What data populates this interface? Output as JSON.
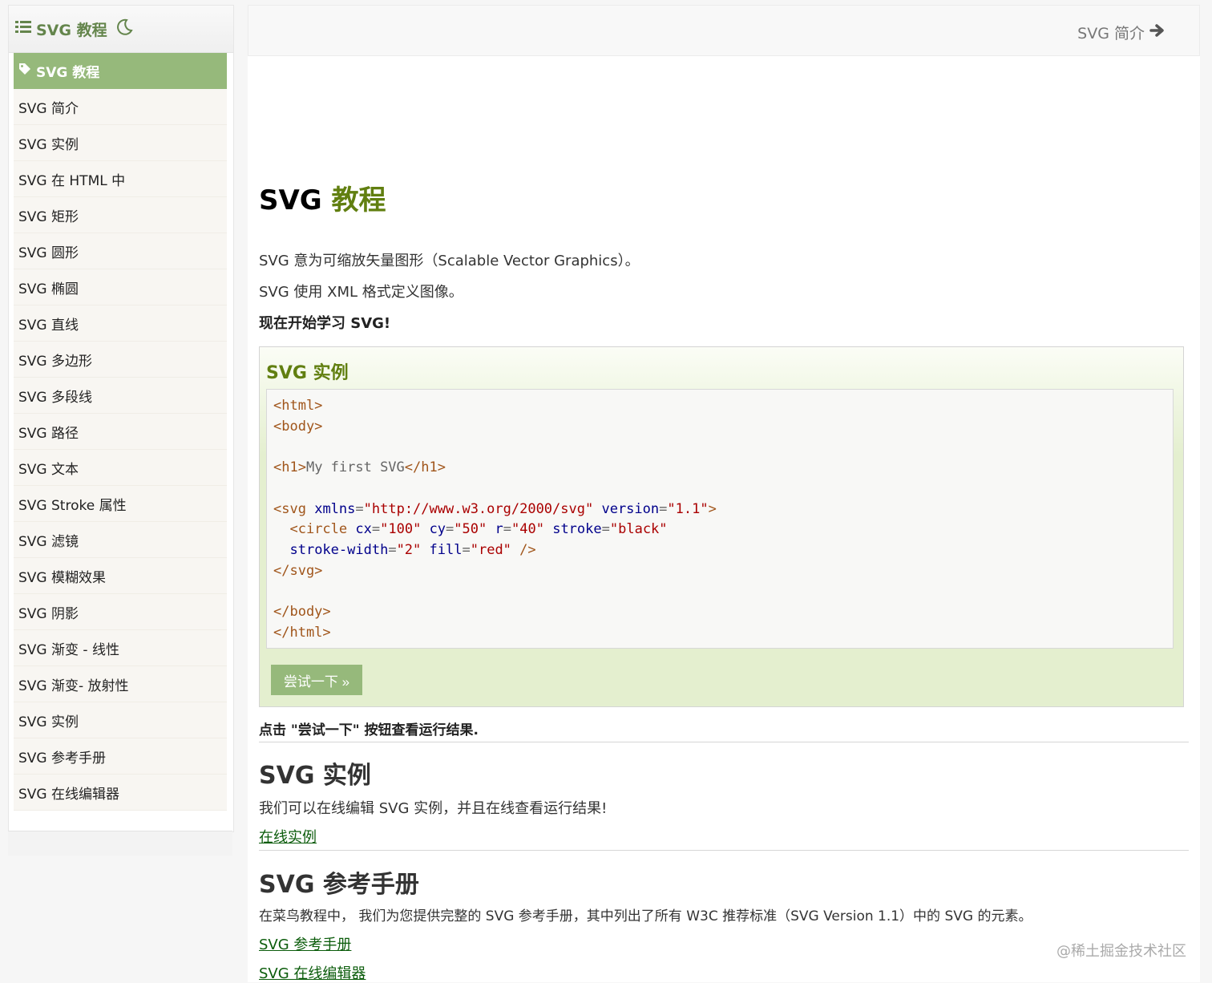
{
  "sidebar": {
    "title": "SVG 教程",
    "items": [
      {
        "label": "SVG 教程",
        "active": true
      },
      {
        "label": "SVG 简介"
      },
      {
        "label": "SVG 实例"
      },
      {
        "label": "SVG 在 HTML 中"
      },
      {
        "label": "SVG 矩形"
      },
      {
        "label": "SVG 圆形"
      },
      {
        "label": "SVG 椭圆"
      },
      {
        "label": "SVG 直线"
      },
      {
        "label": "SVG 多边形"
      },
      {
        "label": "SVG 多段线"
      },
      {
        "label": "SVG 路径"
      },
      {
        "label": "SVG 文本"
      },
      {
        "label": "SVG Stroke 属性"
      },
      {
        "label": "SVG 滤镜"
      },
      {
        "label": "SVG 模糊效果"
      },
      {
        "label": "SVG 阴影"
      },
      {
        "label": "SVG 渐变 - 线性"
      },
      {
        "label": "SVG 渐变- 放射性"
      },
      {
        "label": "SVG 实例"
      },
      {
        "label": "SVG 参考手册"
      },
      {
        "label": "SVG 在线编辑器"
      }
    ]
  },
  "topbar": {
    "next_label": "SVG 简介"
  },
  "main": {
    "title_prefix": "SVG ",
    "title_accent": "教程",
    "intro1": "SVG 意为可缩放矢量图形（Scalable Vector Graphics）。",
    "intro2": "SVG 使用 XML 格式定义图像。",
    "intro3": "现在开始学习 SVG!",
    "example_title": "SVG 实例",
    "try_button": "尝试一下 »",
    "try_hint": "点击 \"尝试一下\" 按钮查看运行结果.",
    "section1_title": "SVG 实例",
    "section1_text": "我们可以在线编辑 SVG 实例，并且在线查看运行结果!",
    "section1_link": "在线实例",
    "section2_title": "SVG 参考手册",
    "section2_text": "在菜鸟教程中， 我们为您提供完整的 SVG 参考手册，其中列出了所有 W3C 推荐标准（SVG Version 1.1）中的 SVG 的元素。",
    "section2_link1": "SVG 参考手册",
    "section2_link2": "SVG 在线编辑器"
  },
  "code": {
    "l1": "<html>",
    "l2": "<body>",
    "l3_open": "<h1>",
    "l3_text": "My first SVG",
    "l3_close": "</h1>",
    "l4_tag": "<svg",
    "l4_a1": "xmlns",
    "l4_v1": "\"http://www.w3.org/2000/svg\"",
    "l4_a2": "version",
    "l4_v2": "\"1.1\"",
    "l4_end": ">",
    "l5_tag": "<circle",
    "l5_a1": "cx",
    "l5_v1": "\"100\"",
    "l5_a2": "cy",
    "l5_v2": "\"50\"",
    "l5_a3": "r",
    "l5_v3": "\"40\"",
    "l5_a4": "stroke",
    "l5_v4": "\"black\"",
    "l6_a1": "stroke-width",
    "l6_v1": "\"2\"",
    "l6_a2": "fill",
    "l6_v2": "\"red\"",
    "l6_end": "/>",
    "l7": "</svg>",
    "l8": "</body>",
    "l9": "</html>",
    "eq": "="
  },
  "watermark": "@稀土掘金技术社区",
  "colors": {
    "accent_green": "#96b97b",
    "title_green": "#617f10",
    "link_green": "#0b5c0b"
  },
  "icons": {
    "sidebar_list": "list-icon",
    "theme": "moon-icon",
    "active_item": "tag-icon",
    "next": "arrow-right-icon"
  }
}
